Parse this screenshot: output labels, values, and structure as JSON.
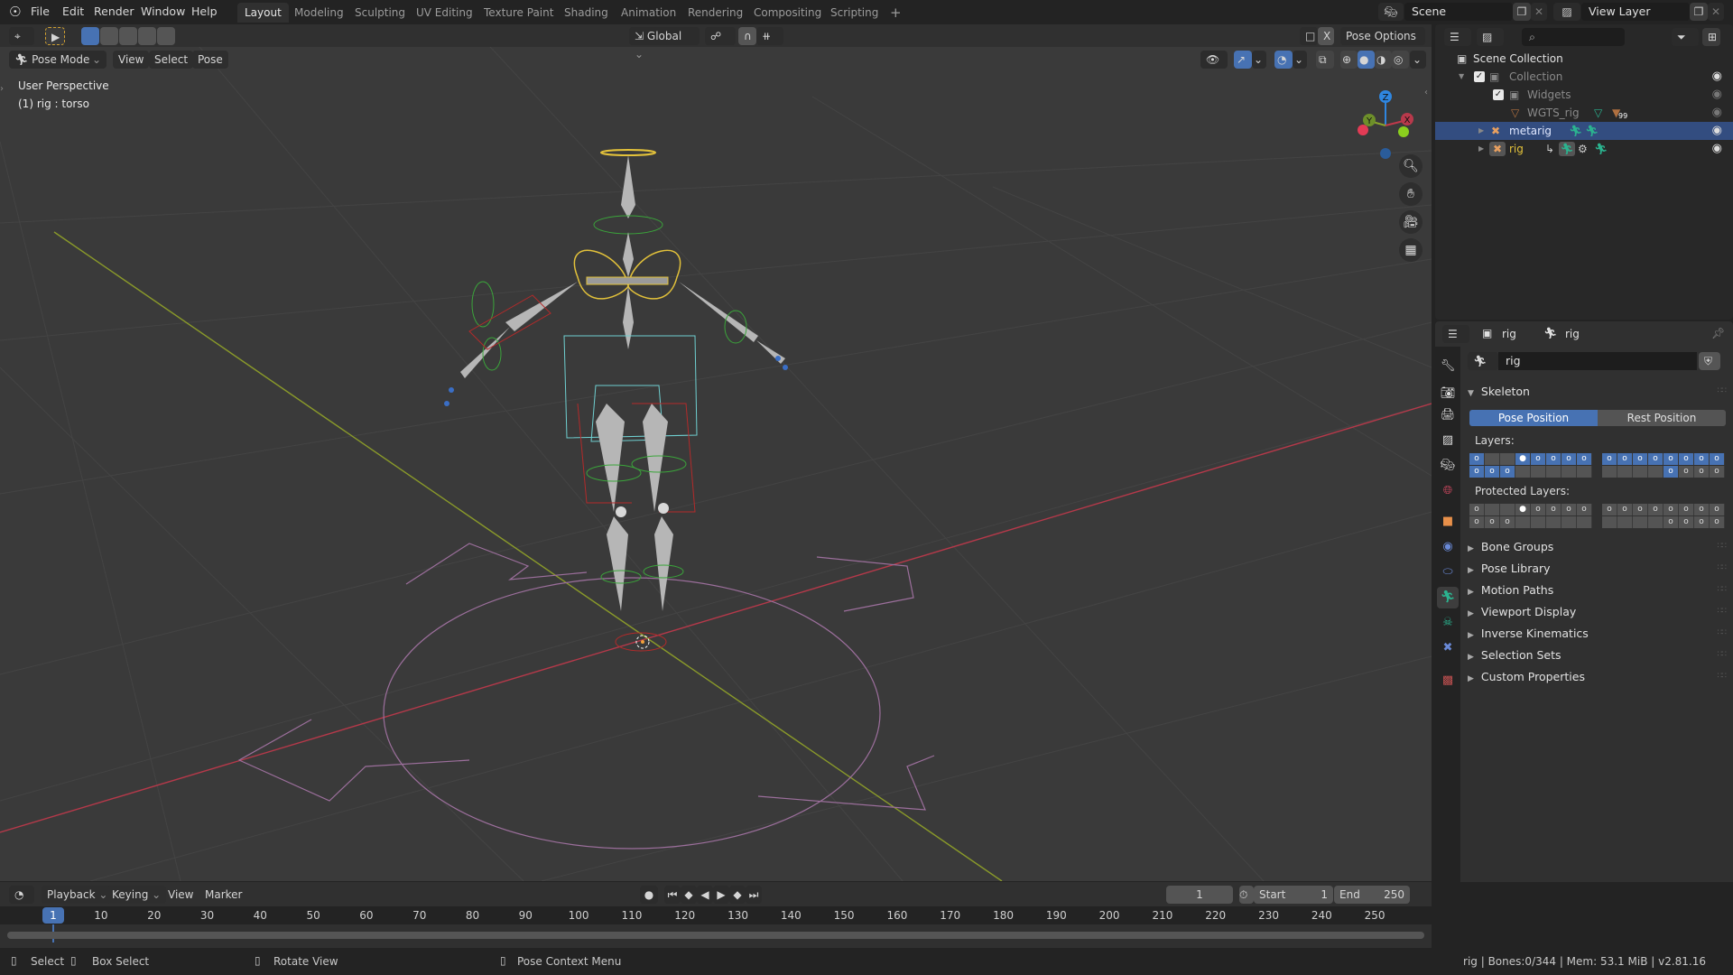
{
  "topbar": {
    "menus": [
      "File",
      "Edit",
      "Render",
      "Window",
      "Help"
    ],
    "workspaces": [
      "Layout",
      "Modeling",
      "Sculpting",
      "UV Editing",
      "Texture Paint",
      "Shading",
      "Animation",
      "Rendering",
      "Compositing",
      "Scripting"
    ],
    "active_workspace": "Layout",
    "add_workspace": "+",
    "scene": "Scene",
    "view_layer": "View Layer"
  },
  "viewport": {
    "header": {
      "transform_orientation": "Global",
      "pose_options": "Pose Options",
      "mirror_x": "X",
      "mode": "Pose Mode",
      "menus": [
        "View",
        "Select",
        "Pose"
      ]
    },
    "overlay_text": {
      "perspective": "User Perspective",
      "active": "(1) rig : torso"
    },
    "gizmo": {
      "z": "Z",
      "y": "Y",
      "x": "X"
    }
  },
  "outliner": {
    "rows": [
      {
        "label": "Scene Collection",
        "icon": "collection-icon",
        "indent": 0
      },
      {
        "label": "Collection",
        "icon": "collection-icon",
        "indent": 1,
        "checked": true
      },
      {
        "label": "Widgets",
        "icon": "collection-icon",
        "indent": 2,
        "checked": true
      },
      {
        "label": "WGTS_rig",
        "icon": "mesh-icon",
        "indent": 3,
        "badge": "99"
      },
      {
        "label": "metarig",
        "icon": "armature-icon",
        "indent": 2,
        "selected": true
      },
      {
        "label": "rig",
        "icon": "armature-icon",
        "indent": 2
      }
    ]
  },
  "properties": {
    "breadcrumb": [
      "rig",
      "rig"
    ],
    "data_name": "rig",
    "skeleton_title": "Skeleton",
    "pose_position": "Pose Position",
    "rest_position": "Rest Position",
    "layers_label": "Layers:",
    "protected_label": "Protected Layers:",
    "layers": {
      "left_top": [
        "on",
        "off",
        "off",
        "active",
        "on",
        "on",
        "on",
        "on"
      ],
      "left_bottom": [
        "on",
        "on",
        "on",
        "off",
        "off",
        "off",
        "off",
        "off"
      ],
      "right_top": [
        "on",
        "on",
        "on",
        "on",
        "on",
        "on",
        "on",
        "on"
      ],
      "right_bottom": [
        "off",
        "off",
        "off",
        "off",
        "on",
        "dot",
        "dot",
        "dot"
      ]
    },
    "protected": {
      "left_top": [
        "dot",
        "off",
        "off",
        "active",
        "dot",
        "dot",
        "dot",
        "dot"
      ],
      "left_bottom": [
        "dot",
        "dot",
        "dot",
        "off",
        "off",
        "off",
        "off",
        "off"
      ],
      "right_top": [
        "dot",
        "dot",
        "dot",
        "dot",
        "dot",
        "dot",
        "dot",
        "dot"
      ],
      "right_bottom": [
        "off",
        "off",
        "off",
        "off",
        "dot",
        "dot",
        "dot",
        "dot"
      ]
    },
    "panels": [
      "Bone Groups",
      "Pose Library",
      "Motion Paths",
      "Viewport Display",
      "Inverse Kinematics",
      "Selection Sets",
      "Custom Properties"
    ]
  },
  "timeline": {
    "menus": [
      "Playback",
      "Keying",
      "View",
      "Marker"
    ],
    "current_frame": "1",
    "start_label": "Start",
    "start": "1",
    "end_label": "End",
    "end": "250",
    "ticks": [
      "10",
      "20",
      "30",
      "40",
      "50",
      "60",
      "70",
      "80",
      "90",
      "100",
      "110",
      "120",
      "130",
      "140",
      "150",
      "160",
      "170",
      "180",
      "190",
      "200",
      "210",
      "220",
      "230",
      "240",
      "250"
    ]
  },
  "statusbar": {
    "select": "Select",
    "box_select": "Box Select",
    "rotate": "Rotate View",
    "context": "Pose Context Menu",
    "info": "rig | Bones:0/344  | Mem: 53.1 MiB | v2.81.16"
  },
  "colors": {
    "accent": "#4772b3",
    "selected_row": "#334d80",
    "x_axis": "#c0394b",
    "y_axis": "#8aa52a",
    "z_axis": "#2f86e0"
  }
}
